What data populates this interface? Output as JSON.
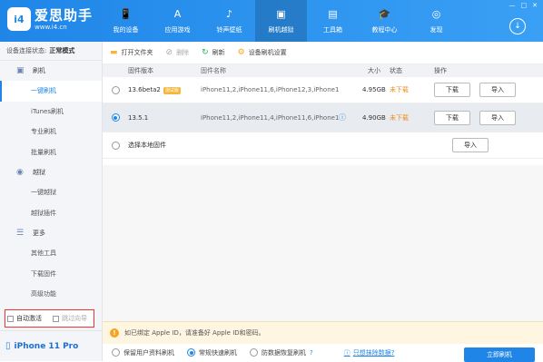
{
  "app": {
    "logo_badge": "i4",
    "logo_name": "爱思助手",
    "logo_url": "www.i4.cn",
    "window_buttons": [
      "—",
      "□",
      "✕"
    ]
  },
  "nav": [
    {
      "label": "我的设备",
      "icon": "📱"
    },
    {
      "label": "应用游戏",
      "icon": "A"
    },
    {
      "label": "铃声壁纸",
      "icon": "♪"
    },
    {
      "label": "刷机越狱",
      "icon": "▣"
    },
    {
      "label": "工具箱",
      "icon": "▤"
    },
    {
      "label": "教程中心",
      "icon": "🎓"
    },
    {
      "label": "发现",
      "icon": "◎"
    }
  ],
  "sidebar": {
    "status_label": "设备连接状态:",
    "status_value": "正常模式",
    "group_flash": "刷机",
    "flash_items": [
      "一键刷机",
      "iTunes刷机",
      "专业刷机",
      "批量刷机"
    ],
    "group_jailbreak": "越狱",
    "jailbreak_items": [
      "一键越狱",
      "越狱插件"
    ],
    "group_more": "更多",
    "more_items": [
      "其他工具",
      "下载固件",
      "高级功能"
    ],
    "auto_activate": "自动激活",
    "skip_wizard": "跳过向导",
    "device_name": "iPhone 11 Pro"
  },
  "toolbar": {
    "open_folder": "打开文件夹",
    "delete": "删除",
    "refresh": "刷新",
    "settings": "设备刷机设置"
  },
  "table": {
    "headers": [
      "固件版本",
      "固件名称",
      "大小",
      "状态",
      "操作"
    ],
    "rows": [
      {
        "version": "13.6beta2",
        "badge": "测试版",
        "name": "iPhone11,2,iPhone11,6,iPhone12,3,iPhone12,...",
        "size": "4.95GB",
        "state": "未下载",
        "download": "下载",
        "import": "导入"
      },
      {
        "version": "13.5.1",
        "badge": "",
        "name": "iPhone11,2,iPhone11,4,iPhone11,6,iPhone12,...",
        "size": "4.90GB",
        "state": "未下载",
        "download": "下载",
        "import": "导入"
      }
    ],
    "local_label": "选择本地固件",
    "local_import": "导入"
  },
  "notice": {
    "text": "如已绑定 Apple ID，请准备好 Apple ID和密码。"
  },
  "footer": {
    "opt_keep": "保留用户资料刷机",
    "opt_fast": "常规快速刷机",
    "opt_recover": "防数据恢复刷机",
    "link": "只想抹除数据?",
    "flash_button": "立即刷机"
  }
}
